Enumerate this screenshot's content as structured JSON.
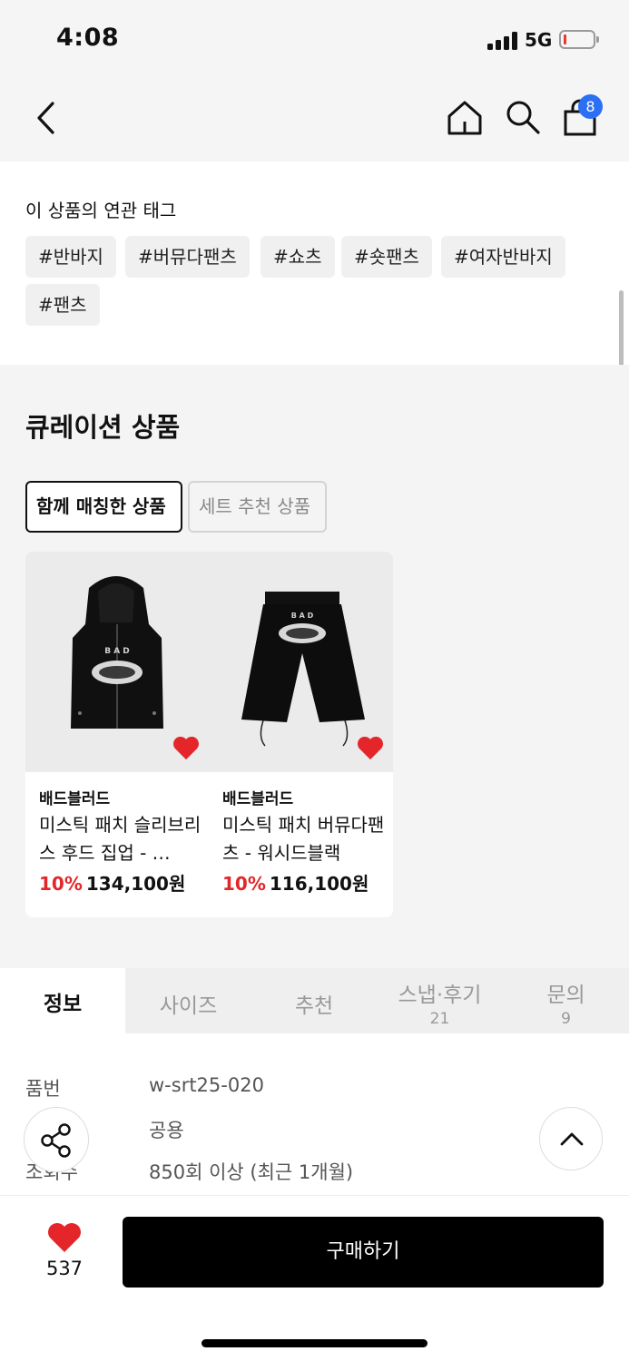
{
  "status": {
    "time": "4:08",
    "network": "5G"
  },
  "nav": {
    "cart_count": "8"
  },
  "tags": {
    "title": "이 상품의 연관 태그",
    "items": [
      "#반바지",
      "#버뮤다팬츠",
      "#쇼츠",
      "#숏팬츠",
      "#여자반바지",
      "#팬츠"
    ]
  },
  "curation": {
    "title": "큐레이션 상품",
    "tabs": [
      "함께 매칭한 상품",
      "세트 추천 상품"
    ],
    "products": [
      {
        "brand": "배드블러드",
        "name": "미스틱 패치 슬리브리스 후드 집업 - …",
        "discount": "10%",
        "price": "134,100원"
      },
      {
        "brand": "배드블러드",
        "name": "미스틱 패치 버뮤다팬츠 - 워시드블랙",
        "discount": "10%",
        "price": "116,100원"
      }
    ]
  },
  "tabs": [
    {
      "label": "정보",
      "count": ""
    },
    {
      "label": "사이즈",
      "count": ""
    },
    {
      "label": "추천",
      "count": ""
    },
    {
      "label": "스냅·후기",
      "count": "21"
    },
    {
      "label": "문의",
      "count": "9"
    }
  ],
  "info": {
    "rows": [
      {
        "key": "품번",
        "value": "w-srt25-020"
      },
      {
        "key": "",
        "value": "공용"
      },
      {
        "key": "조회수",
        "value": "850회 이상 (최근 1개월)"
      }
    ]
  },
  "bottom": {
    "like_count": "537",
    "buy_label": "구매하기"
  },
  "colors": {
    "accent_red": "#e4262a",
    "badge_blue": "#2b6ff2"
  },
  "icons": [
    "back-icon",
    "home-icon",
    "search-icon",
    "bag-icon",
    "heart-icon",
    "share-icon",
    "chevron-up-icon"
  ]
}
